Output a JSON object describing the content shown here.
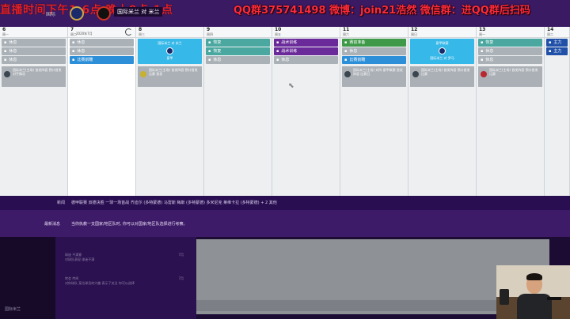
{
  "overlay": {
    "stream_time": "直播时间下午1-6点 晚上8点-1点",
    "contact": "QQ群375741498 微博：join21浩然 微信群：进QQ群后扫码"
  },
  "header": {
    "team_left": "国际",
    "match_label": "国际米兰 对 米兰"
  },
  "calendar": {
    "today_date": "2020年7月",
    "days": [
      {
        "num": "6",
        "wk": "周一",
        "events": [
          {
            "color": "gray",
            "label": "休息"
          },
          {
            "color": "gray",
            "label": "休息"
          },
          {
            "color": "gray",
            "label": "休息"
          }
        ],
        "card": {
          "text": "国际米兰(主场) 首发阵容 预计首发 对手情况"
        }
      },
      {
        "num": "7",
        "wk": "周二",
        "events": [
          {
            "color": "gray",
            "label": "休息"
          },
          {
            "color": "gray",
            "label": "休息"
          },
          {
            "color": "blue",
            "label": "比赛前瞻"
          }
        ]
      },
      {
        "num": "8",
        "wk": "周三",
        "match": {
          "top": "国际米兰 对 米兰",
          "bottom": "意甲",
          "crest": "inter-crest"
        },
        "card": {
          "text": "国际米兰(主场) 首发阵容 预计首发 比赛 首发"
        }
      },
      {
        "num": "9",
        "wk": "周四",
        "events": [
          {
            "color": "teal",
            "label": "恢复"
          },
          {
            "color": "teal",
            "label": "恢复"
          },
          {
            "color": "gray",
            "label": "休息"
          }
        ]
      },
      {
        "num": "10",
        "wk": "周五",
        "events": [
          {
            "color": "purple",
            "label": "战术训练"
          },
          {
            "color": "purple",
            "label": "战术训练"
          },
          {
            "color": "gray",
            "label": "休息"
          }
        ]
      },
      {
        "num": "11",
        "wk": "周六",
        "events": [
          {
            "color": "green",
            "label": "赛前准备"
          },
          {
            "color": "gray",
            "label": "休息"
          },
          {
            "color": "blue",
            "label": "比赛前瞻"
          }
        ],
        "card": {
          "text": "国际米兰(主场) 对阵 意甲联赛 首发阵容 比赛日"
        }
      },
      {
        "num": "12",
        "wk": "周日",
        "match": {
          "top": "意甲联赛",
          "bottom": "国际米兰 对 罗马",
          "crest": "roma-crest"
        },
        "card": {
          "text": "国际米兰(主场) 首发阵容 预计首发 比赛"
        }
      },
      {
        "num": "13",
        "wk": "周一",
        "events": [
          {
            "color": "teal",
            "label": "恢复"
          },
          {
            "color": "gray",
            "label": "休息"
          },
          {
            "color": "gray",
            "label": "休息"
          }
        ],
        "card": {
          "text": "国际米兰(主场) 首发阵容 预计首发 比赛"
        }
      },
      {
        "num": "14",
        "wk": "周二",
        "events": [
          {
            "color": "navy",
            "label": "主力"
          },
          {
            "color": "navy",
            "label": "主力"
          }
        ]
      }
    ]
  },
  "ticker": {
    "label": "新闻",
    "text": "德甲联赛 双德决胜 一球一场首战 齐迪尔 (多特蒙德) 马雷斯 梅斯 (多特蒙德) 多米尼克 莱维卡拉 (多特蒙德) + 2 其他"
  },
  "news": {
    "label": "最新消息",
    "text": "当你执教一支国家/地区队时, 你可以对国家/地区队选择进行考察。"
  },
  "messages": [
    {
      "title": "球迷 不满意",
      "sub": "对球队表现 球迷不满",
      "time": "7月"
    },
    {
      "title": "转会 传闻",
      "sub": "对你球队 某位球员的兴趣 表示了关注 你可以选择",
      "time": "7月"
    }
  ],
  "sidebar": {
    "user": "国际米兰"
  },
  "colors": {
    "purple_dark": "#241040",
    "purple_bar": "#3a1a63",
    "today_blue": "#36b8e8",
    "overlay_red": "#ff2a3a"
  }
}
